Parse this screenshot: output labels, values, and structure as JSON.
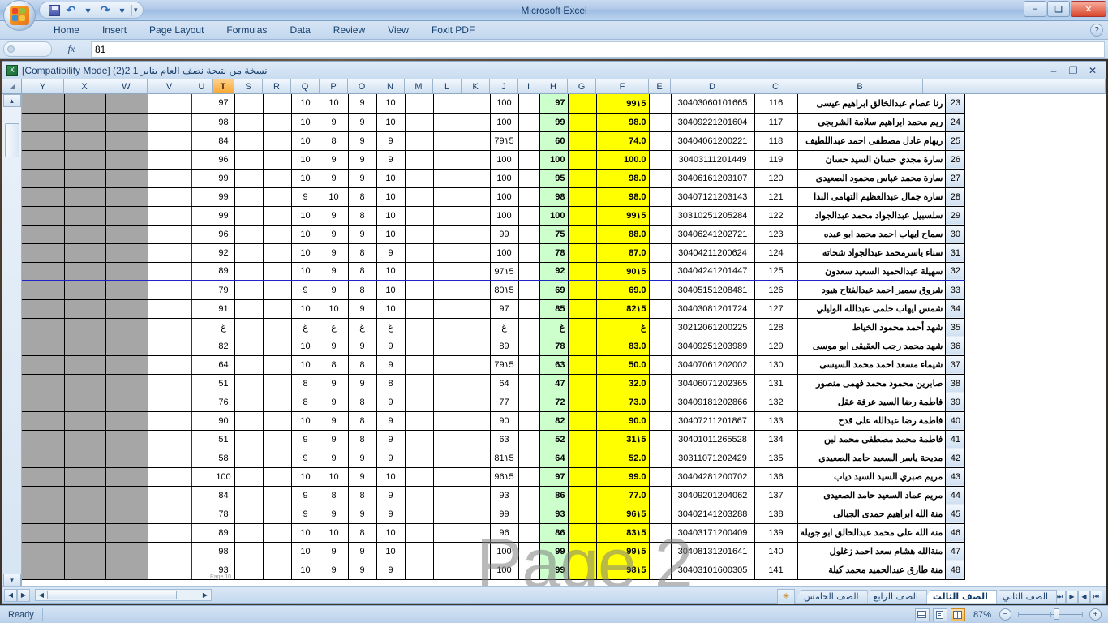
{
  "app": {
    "window_title": "Microsoft Excel",
    "minimize": "–",
    "maximize": "❑",
    "close": "✕"
  },
  "quick_access": {
    "save": "save-icon",
    "undo": "↶",
    "redo": "↷",
    "customize": "▾"
  },
  "ribbon": {
    "tabs": [
      "Home",
      "Insert",
      "Page Layout",
      "Formulas",
      "Data",
      "Review",
      "View",
      "Foxit PDF"
    ],
    "help": "?"
  },
  "formula_bar": {
    "name_box": "",
    "fx_label": "fx",
    "value": "81"
  },
  "document": {
    "title": "نسخة من نتيجة نصف العام يناير 1 2(2)  [Compatibility Mode]",
    "minimize": "–",
    "restore": "❐",
    "close": "✕"
  },
  "grid": {
    "columns": [
      "Y",
      "X",
      "W",
      "V",
      "U",
      "T",
      "S",
      "R",
      "Q",
      "P",
      "O",
      "N",
      "M",
      "L",
      "K",
      "J",
      "I",
      "H",
      "G",
      "F",
      "E",
      "D",
      "C",
      "B"
    ],
    "selected_column": "T",
    "row_numbers": [
      23,
      24,
      25,
      26,
      27,
      28,
      29,
      30,
      31,
      32,
      33,
      34,
      35,
      36,
      37,
      38,
      39,
      40,
      41,
      42,
      43,
      44,
      45,
      46,
      47,
      48
    ],
    "watermark": "Page 2",
    "page_break_label": "Page 10",
    "rows": [
      {
        "T": "97",
        "Q": "10",
        "P": "10",
        "O": "9",
        "N": "10",
        "J": "100",
        "H": "97",
        "F": "99١5",
        "D": "30403060101665",
        "C": "116",
        "B": "رنا عصام عبدالخالق ابراهيم عيسى",
        "r": 23
      },
      {
        "T": "98",
        "Q": "10",
        "P": "9",
        "O": "9",
        "N": "10",
        "J": "100",
        "H": "99",
        "F": "98.0",
        "D": "30409221201604",
        "C": "117",
        "B": "ريم محمد ابراهيم سلامة الشربجى",
        "r": 24
      },
      {
        "T": "84",
        "Q": "10",
        "P": "8",
        "O": "9",
        "N": "9",
        "J": "79١5",
        "H": "60",
        "F": "74.0",
        "D": "30404061200221",
        "C": "118",
        "B": "ريهام عادل مصطفى احمد عبداللطيف",
        "r": 25
      },
      {
        "T": "96",
        "Q": "10",
        "P": "9",
        "O": "9",
        "N": "9",
        "J": "100",
        "H": "100",
        "F": "100.0",
        "D": "30403111201449",
        "C": "119",
        "B": "سارة مجدي حسان السيد حسان",
        "r": 26
      },
      {
        "T": "99",
        "Q": "10",
        "P": "9",
        "O": "9",
        "N": "10",
        "J": "100",
        "H": "95",
        "F": "98.0",
        "D": "30406161203107",
        "C": "120",
        "B": "سارة محمد عباس محمود الصعيدى",
        "r": 27
      },
      {
        "T": "99",
        "Q": "9",
        "P": "10",
        "O": "8",
        "N": "10",
        "J": "100",
        "H": "98",
        "F": "98.0",
        "D": "30407121203143",
        "C": "121",
        "B": "سارة جمال عبدالعظيم التهامى البدا",
        "r": 28
      },
      {
        "T": "99",
        "Q": "10",
        "P": "9",
        "O": "8",
        "N": "10",
        "J": "100",
        "H": "100",
        "F": "99١5",
        "D": "30310251205284",
        "C": "122",
        "B": "سلسبيل عبدالجواد محمد عبدالجواد",
        "r": 29
      },
      {
        "T": "96",
        "Q": "10",
        "P": "9",
        "O": "9",
        "N": "10",
        "J": "99",
        "H": "75",
        "F": "88.0",
        "D": "30406241202721",
        "C": "123",
        "B": "سماح ايهاب احمد محمد ابو عبده",
        "r": 30
      },
      {
        "T": "92",
        "Q": "10",
        "P": "9",
        "O": "8",
        "N": "9",
        "J": "100",
        "H": "78",
        "F": "87.0",
        "D": "30404211200624",
        "C": "124",
        "B": "سناء ياسرمحمد عبدالجواد شحاته",
        "r": 31
      },
      {
        "T": "89",
        "Q": "10",
        "P": "9",
        "O": "8",
        "N": "10",
        "J": "97١5",
        "H": "92",
        "F": "90١5",
        "D": "30404241201447",
        "C": "125",
        "B": "سهيلة عبدالحميد السعيد سعدون",
        "r": 32
      },
      {
        "T": "79",
        "Q": "9",
        "P": "9",
        "O": "8",
        "N": "10",
        "J": "80١5",
        "H": "69",
        "F": "69.0",
        "D": "30405151208481",
        "C": "126",
        "B": "شروق سمير احمد عبدالفتاح هيود",
        "r": 33,
        "sep": true
      },
      {
        "T": "91",
        "Q": "10",
        "P": "10",
        "O": "9",
        "N": "10",
        "J": "97",
        "H": "85",
        "F": "82١5",
        "D": "30403081201724",
        "C": "127",
        "B": "شمس ايهاب حلمى عبدالله الوليلي",
        "r": 34
      },
      {
        "T": "غ",
        "Q": "غ",
        "P": "غ",
        "O": "غ",
        "N": "غ",
        "J": "غ",
        "H": "غ",
        "F": "غ",
        "D": "30212061200225",
        "C": "128",
        "B": "شهد أحمد محمود الخياط",
        "r": 35
      },
      {
        "T": "82",
        "Q": "10",
        "P": "9",
        "O": "9",
        "N": "9",
        "J": "89",
        "H": "78",
        "F": "83.0",
        "D": "30409251203989",
        "C": "129",
        "B": "شهد محمد رجب العقيقى ابو موسى",
        "r": 36
      },
      {
        "T": "64",
        "Q": "10",
        "P": "8",
        "O": "8",
        "N": "9",
        "J": "79١5",
        "H": "63",
        "F": "50.0",
        "D": "30407061202002",
        "C": "130",
        "B": "شيماء مسعد احمد محمد السيسى",
        "r": 37
      },
      {
        "T": "51",
        "Q": "8",
        "P": "9",
        "O": "9",
        "N": "8",
        "J": "64",
        "H": "47",
        "F": "32.0",
        "D": "30406071202365",
        "C": "131",
        "B": "صابرين محمود محمد فهمى منصور",
        "r": 38
      },
      {
        "T": "76",
        "Q": "8",
        "P": "9",
        "O": "8",
        "N": "9",
        "J": "77",
        "H": "72",
        "F": "73.0",
        "D": "30409181202866",
        "C": "132",
        "B": "فاطمة رضا السيد عرفة عقل",
        "r": 39
      },
      {
        "T": "90",
        "Q": "10",
        "P": "9",
        "O": "8",
        "N": "9",
        "J": "90",
        "H": "82",
        "F": "90.0",
        "D": "30407211201867",
        "C": "133",
        "B": "فاطمة رضا عبدالله على قدح",
        "r": 40
      },
      {
        "T": "51",
        "Q": "9",
        "P": "9",
        "O": "8",
        "N": "9",
        "J": "63",
        "H": "52",
        "F": "31١5",
        "D": "30401011265528",
        "C": "134",
        "B": "فاطمة محمد مصطفى محمد لبن",
        "r": 41
      },
      {
        "T": "58",
        "Q": "9",
        "P": "9",
        "O": "9",
        "N": "9",
        "J": "81١5",
        "H": "64",
        "F": "52.0",
        "D": "30311071202429",
        "C": "135",
        "B": "مديحة ياسر السعيد حامد الصعيدي",
        "r": 42
      },
      {
        "T": "100",
        "Q": "10",
        "P": "10",
        "O": "9",
        "N": "10",
        "J": "96١5",
        "H": "97",
        "F": "99.0",
        "D": "30404281200702",
        "C": "136",
        "B": "مريم صبري السيد السيد دياب",
        "r": 43
      },
      {
        "T": "84",
        "Q": "9",
        "P": "8",
        "O": "8",
        "N": "9",
        "J": "93",
        "H": "86",
        "F": "77.0",
        "D": "30409201204062",
        "C": "137",
        "B": "مريم عماد السعيد حامد الصعيدى",
        "r": 44
      },
      {
        "T": "78",
        "Q": "9",
        "P": "9",
        "O": "9",
        "N": "9",
        "J": "99",
        "H": "93",
        "F": "96١5",
        "D": "30402141203288",
        "C": "138",
        "B": "منة الله ابراهيم حمدى الجبالى",
        "r": 45
      },
      {
        "T": "89",
        "Q": "10",
        "P": "10",
        "O": "8",
        "N": "10",
        "J": "96",
        "H": "86",
        "F": "83١5",
        "D": "30403171200409",
        "C": "139",
        "B": "منة الله على محمد عبدالخالق ابو جويلة",
        "r": 46
      },
      {
        "T": "98",
        "Q": "10",
        "P": "9",
        "O": "9",
        "N": "10",
        "J": "100",
        "H": "99",
        "F": "99١5",
        "D": "30408131201641",
        "C": "140",
        "B": "منةالله هشام سعد احمد زغلول",
        "r": 47
      },
      {
        "T": "93",
        "Q": "10",
        "P": "9",
        "O": "9",
        "N": "9",
        "J": "100",
        "H": "99",
        "F": "98١5",
        "D": "30403101600305",
        "C": "141",
        "B": "منة طارق عبدالحميد محمد كيلة",
        "r": 48
      }
    ]
  },
  "sheet_tabs": {
    "nav_first": "⏮",
    "nav_prev": "◀",
    "nav_next": "▶",
    "nav_last": "⏭",
    "tabs": [
      {
        "label": "الصف الثاني",
        "active": false
      },
      {
        "label": "الصف الثالث",
        "active": true
      },
      {
        "label": "الصف الرابع",
        "active": false
      },
      {
        "label": "الصف الخامس",
        "active": false
      }
    ],
    "new_sheet": "✳"
  },
  "status_bar": {
    "mode": "Ready",
    "view_normal": "normal-view-icon",
    "view_layout": "page-layout-view-icon",
    "view_break": "page-break-preview-icon",
    "zoom": "87%",
    "zoom_out": "−",
    "zoom_in": "+"
  },
  "colors": {
    "accent": "#1f24c4",
    "highlight_yellow": "#ffff00",
    "highlight_green": "#ccffcc",
    "selected_header": "#f7a834"
  }
}
